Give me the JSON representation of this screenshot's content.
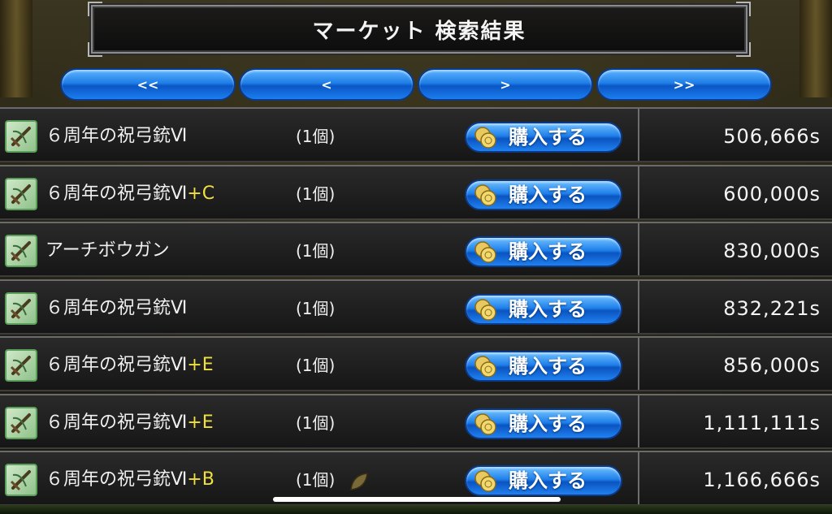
{
  "title": "マーケット 検索結果",
  "pager": {
    "first": "<<",
    "prev": "<",
    "next": ">",
    "last": ">>"
  },
  "buy_label": "購入する",
  "items": [
    {
      "name": "６周年の祝弓銃Ⅵ",
      "suffix": "",
      "qty": "(1個)",
      "price": "506,666s",
      "has_leaf": false
    },
    {
      "name": "６周年の祝弓銃Ⅵ",
      "suffix": "+C",
      "qty": "(1個)",
      "price": "600,000s",
      "has_leaf": false
    },
    {
      "name": "アーチボウガン",
      "suffix": "",
      "qty": "(1個)",
      "price": "830,000s",
      "has_leaf": false
    },
    {
      "name": "６周年の祝弓銃Ⅵ",
      "suffix": "",
      "qty": "(1個)",
      "price": "832,221s",
      "has_leaf": false
    },
    {
      "name": "６周年の祝弓銃Ⅵ",
      "suffix": "+E",
      "qty": "(1個)",
      "price": "856,000s",
      "has_leaf": false
    },
    {
      "name": "６周年の祝弓銃Ⅵ",
      "suffix": "+E",
      "qty": "(1個)",
      "price": "1,111,111s",
      "has_leaf": false
    },
    {
      "name": "６周年の祝弓銃Ⅵ",
      "suffix": "+B",
      "qty": "(1個)",
      "price": "1,166,666s",
      "has_leaf": true
    }
  ],
  "colors": {
    "suffix": "#f0e040",
    "button_blue": "#1f80ea",
    "icon_green": "#8fc28a"
  },
  "icons": {
    "item": "crossbow-icon",
    "coin": "coin-icon",
    "leaf": "leaf-icon"
  }
}
